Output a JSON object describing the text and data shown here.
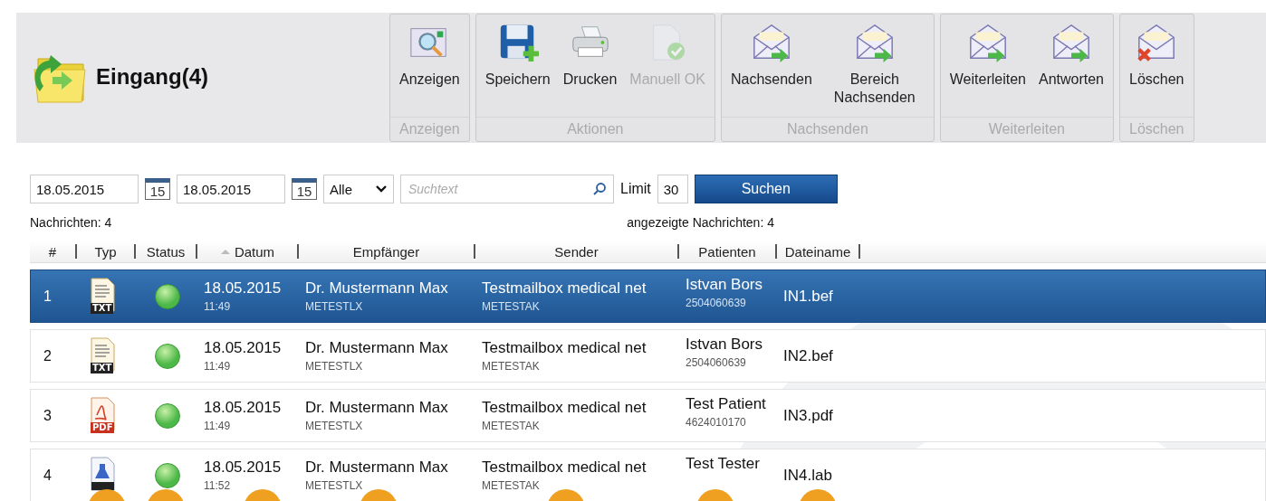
{
  "header": {
    "title": "Eingang(4)"
  },
  "ribbon": [
    {
      "label": "Anzeigen",
      "buttons": [
        {
          "label": "Anzeigen",
          "kind": "view",
          "disabled": false
        }
      ]
    },
    {
      "label": "Aktionen",
      "buttons": [
        {
          "label": "Speichern",
          "kind": "save",
          "disabled": false
        },
        {
          "label": "Drucken",
          "kind": "print",
          "disabled": false
        },
        {
          "label": "Manuell OK",
          "kind": "ok",
          "disabled": true
        }
      ]
    },
    {
      "label": "Nachsenden",
      "buttons": [
        {
          "label": "Nachsenden",
          "kind": "mail",
          "disabled": false
        },
        {
          "label": "Bereich Nachsenden",
          "kind": "mail",
          "disabled": false
        }
      ]
    },
    {
      "label": "Weiterleiten",
      "buttons": [
        {
          "label": "Weiterleiten",
          "kind": "mail",
          "disabled": false
        },
        {
          "label": "Antworten",
          "kind": "mail",
          "disabled": false
        }
      ]
    },
    {
      "label": "Löschen",
      "buttons": [
        {
          "label": "Löschen",
          "kind": "delete",
          "disabled": false
        }
      ]
    }
  ],
  "filter": {
    "date_from": "18.05.2015",
    "calendar_day_1": "15",
    "date_to": "18.05.2015",
    "calendar_day_2": "15",
    "type_select": "Alle",
    "search": {
      "placeholder": "Suchtext"
    },
    "limit_label": "Limit",
    "limit": "30",
    "search_button": "Suchen"
  },
  "counts": {
    "total": "Nachrichten: 4",
    "shown": "angezeigte Nachrichten: 4"
  },
  "table": {
    "columns": [
      "#",
      "Typ",
      "Status",
      "Datum",
      "Empfänger",
      "Sender",
      "Patienten",
      "Dateiname"
    ],
    "rows": [
      {
        "number": "1",
        "kind": "txt",
        "type_label": "TXT",
        "date": "18.05.2015",
        "time": "11:49",
        "recipient": "Dr. Mustermann Max",
        "recipient_code": "METESTLX",
        "sender": "Testmailbox medical net",
        "sender_code": "METESTAK",
        "patient": "Istvan Bors",
        "patient_id": "2504060639",
        "filename": "IN1.bef",
        "selected": true
      },
      {
        "number": "2",
        "kind": "txt",
        "type_label": "TXT",
        "date": "18.05.2015",
        "time": "11:49",
        "recipient": "Dr. Mustermann Max",
        "recipient_code": "METESTLX",
        "sender": "Testmailbox medical net",
        "sender_code": "METESTAK",
        "patient": "Istvan Bors",
        "patient_id": "2504060639",
        "filename": "IN2.bef",
        "selected": false
      },
      {
        "number": "3",
        "kind": "pdf",
        "type_label": "PDF",
        "date": "18.05.2015",
        "time": "11:49",
        "recipient": "Dr. Mustermann Max",
        "recipient_code": "METESTLX",
        "sender": "Testmailbox medical net",
        "sender_code": "METESTAK",
        "patient": "Test Patient",
        "patient_id": "4624010170",
        "filename": "IN3.pdf",
        "selected": false
      },
      {
        "number": "4",
        "kind": "lab",
        "date": "18.05.2015",
        "time": "11:52",
        "recipient": "Dr. Mustermann Max",
        "recipient_code": "METESTLX",
        "sender": "Testmailbox medical net",
        "sender_code": "METESTAK",
        "patient": "Test Tester",
        "filename": "IN4.lab",
        "selected": false
      }
    ]
  },
  "annotation_markers": [
    {
      "kind": "marker"
    },
    {
      "kind": "marker"
    },
    {
      "kind": "marker"
    },
    {
      "kind": "marker"
    },
    {
      "kind": "marker"
    },
    {
      "kind": "marker"
    },
    {
      "kind": "marker"
    }
  ]
}
